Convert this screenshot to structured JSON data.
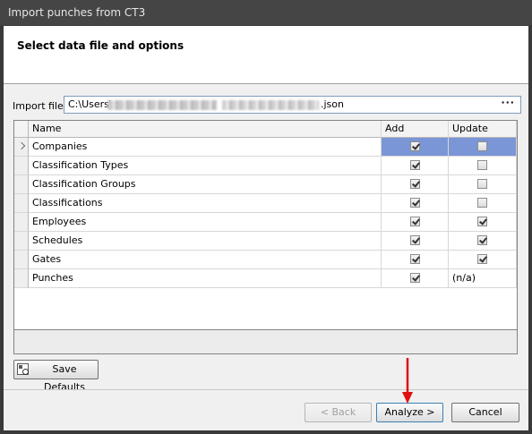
{
  "window": {
    "title": "Import punches from CT3"
  },
  "header": {
    "title": "Select data file and options"
  },
  "file": {
    "label": "Import file:",
    "path_prefix": "C:\\Users\\",
    "path_suffix": ".json",
    "browse": "···"
  },
  "grid": {
    "columns": [
      "Name",
      "Add",
      "Update"
    ],
    "rows": [
      {
        "name": "Companies",
        "add": true,
        "update": false,
        "selected": true
      },
      {
        "name": "Classification Types",
        "add": true,
        "update": false
      },
      {
        "name": "Classification Groups",
        "add": true,
        "update": false
      },
      {
        "name": "Classifications",
        "add": true,
        "update": false
      },
      {
        "name": "Employees",
        "add": true,
        "update": true
      },
      {
        "name": "Schedules",
        "add": true,
        "update": true
      },
      {
        "name": "Gates",
        "add": true,
        "update": true
      },
      {
        "name": "Punches",
        "add": true,
        "update_text": "(n/a)"
      }
    ]
  },
  "buttons": {
    "save_defaults": "Save Defaults",
    "back": "< Back",
    "analyze": "Analyze >",
    "cancel": "Cancel"
  },
  "colors": {
    "selection": "#7b96d6",
    "arrow": "#e01010",
    "titlebar": "#454545"
  }
}
